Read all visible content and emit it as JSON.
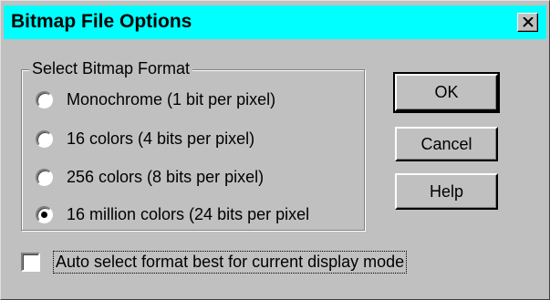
{
  "window": {
    "title": "Bitmap File Options",
    "close_icon": "close-x-icon",
    "title_bar_color": "#00ffff",
    "face_color": "#c0c0c0"
  },
  "format_group": {
    "label": "Select Bitmap Format",
    "options": [
      {
        "label": "Monochrome (1 bit per pixel)",
        "checked": false
      },
      {
        "label": "16 colors (4 bits per pixel)",
        "checked": false
      },
      {
        "label": "256 colors (8 bits per pixel)",
        "checked": false
      },
      {
        "label": "16 million colors (24 bits per pixel",
        "checked": true
      }
    ]
  },
  "buttons": {
    "ok_label": "OK",
    "cancel_label": "Cancel",
    "help_label": "Help"
  },
  "auto_select": {
    "label": "Auto select format best for current display mode",
    "checked": false
  }
}
